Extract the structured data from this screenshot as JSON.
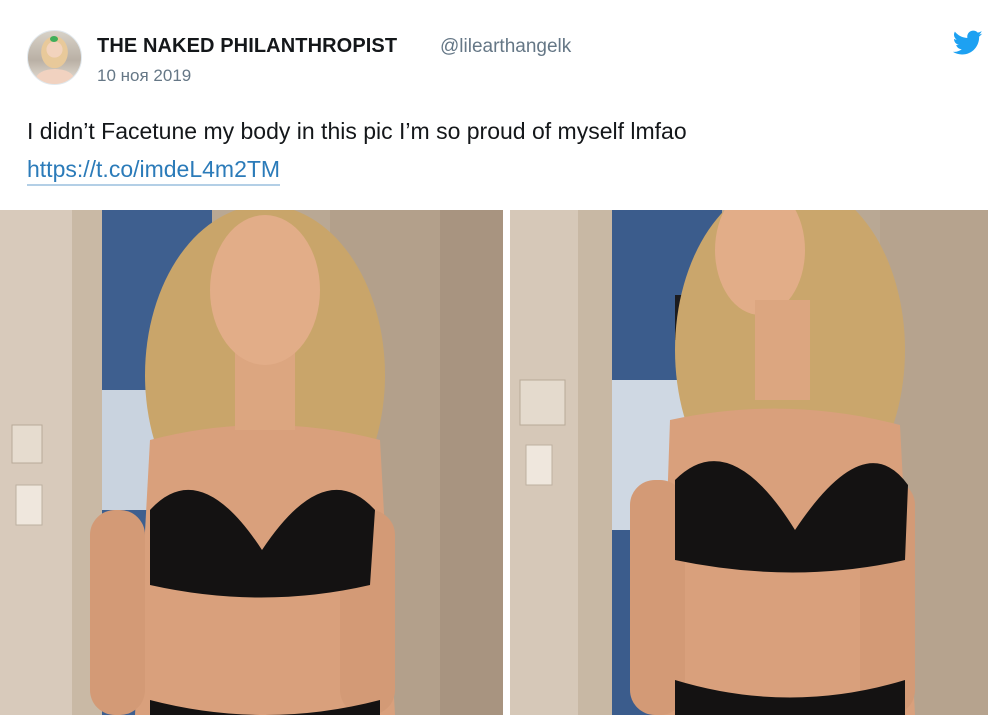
{
  "tweet": {
    "author_name": "THE NAKED PHILANTHROPIST",
    "author_handle": "@lilearthangelk",
    "date": "10 ноя 2019",
    "text": "I didn’t Facetune my body in this pic I’m so proud of myself lmfao",
    "link": "https://t.co/imdeL4m2TM",
    "avatar_icon": "avatar",
    "brand_icon": "twitter-bird-icon",
    "brand_color": "#1da1f2",
    "link_color": "#2b7bb9"
  },
  "media": {
    "photos": [
      {
        "name": "photo-left"
      },
      {
        "name": "photo-right"
      }
    ]
  }
}
